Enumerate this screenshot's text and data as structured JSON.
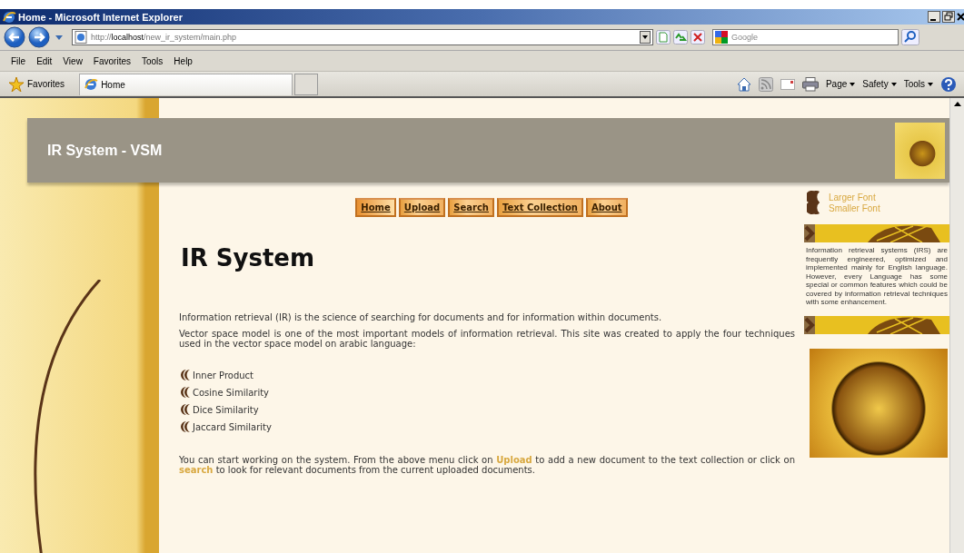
{
  "window": {
    "title": "Home - Microsoft Internet Explorer"
  },
  "address_bar": {
    "url_prefix": "http://",
    "url_host": "localhost",
    "url_path": "/new_ir_system/main.php"
  },
  "search_box": {
    "placeholder": "Google"
  },
  "menu": [
    "File",
    "Edit",
    "View",
    "Favorites",
    "Tools",
    "Help"
  ],
  "favorites_bar": {
    "favorites": "Favorites",
    "tabs": [
      {
        "label": "Home",
        "selected": true
      }
    ]
  },
  "command_bar": [
    "Page",
    "Safety",
    "Tools"
  ],
  "site": {
    "title": "IR System - VSM",
    "nav": [
      {
        "label": "Home",
        "selected": true
      },
      {
        "label": "Upload",
        "selected": false
      },
      {
        "label": "Search",
        "selected": false
      },
      {
        "label": "Text Collection",
        "selected": false
      },
      {
        "label": "About",
        "selected": false
      }
    ],
    "heading": "IR System",
    "paragraphs": [
      "Information retrieval (IR) is the science of searching for documents and for information within documents.",
      "Vector space model is one of the most important models of information retrieval. This site was created to apply the four techniques used in the vector space model on arabic language:"
    ],
    "techniques": [
      "Inner Product",
      "Cosine Similarity",
      "Dice Similarity",
      "Jaccard Similarity"
    ],
    "closing": [
      {
        "kind": "text",
        "text": "You can start working on the system. From the above menu click on "
      },
      {
        "kind": "link",
        "text": "Upload"
      },
      {
        "kind": "text",
        "text": " to add a new document to the text collection or click on "
      },
      {
        "kind": "link",
        "text": "search"
      },
      {
        "kind": "text",
        "text": " to look for relevant documents from the current uploaded documents."
      }
    ],
    "font_links": [
      "Larger Font",
      "Smaller Font"
    ],
    "sidebar_text": "Information retrieval systems (IRS) are frequently engineered, optimized and implemented mainly for English language. However, every Language has some special or common features which could be covered by information retrieval techniques with some enhancement."
  }
}
